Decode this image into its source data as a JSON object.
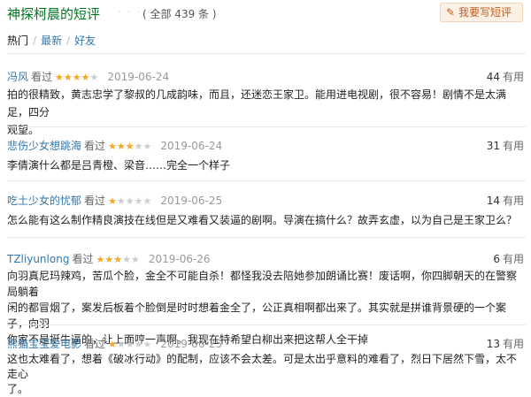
{
  "header": {
    "title": "神探柯晨的短评",
    "dots": "· · · · · ·",
    "total": "( 全部 439 条 )",
    "write_button_icon": "pencil-icon",
    "write_button": "我要写短评"
  },
  "tabs": {
    "hot": "热门",
    "sep1": "/",
    "latest": "最新",
    "sep2": "/",
    "friends": "好友"
  },
  "colors": {
    "title_green": "#007722",
    "link_blue": "#3377aa",
    "star_orange": "#f5a623",
    "button_text": "#bf5b1c"
  },
  "reviews": [
    {
      "user": "冯风",
      "status": "看过",
      "rating": 4,
      "date": "2019-06-24",
      "useful_count": "44",
      "useful_label": "有用",
      "line1": "拍的很精致，黄志忠学了黎叔的几成韵味，而且，还迷恋王家卫。能用进电视剧，很不容易！剧情不是太满足，四分",
      "line2": "观望。",
      "line3": ""
    },
    {
      "user": "悲伤少女想跳海",
      "status": "看过",
      "rating": 3,
      "date": "2019-06-24",
      "useful_count": "31",
      "useful_label": "有用",
      "line1": "李倩演什么都是吕青橙、梁音……完全一个样子",
      "line2": "",
      "line3": ""
    },
    {
      "user": "吃土少女的忧郁",
      "status": "看过",
      "rating": 1,
      "date": "2019-06-25",
      "useful_count": "14",
      "useful_label": "有用",
      "line1": "怎么能有这么制作精良演技在线但是又难看又装逼的剧啊。导演在搞什么？故弄玄虚，以为自己是王家卫么？",
      "line2": "",
      "line3": ""
    },
    {
      "user": "TZliyunlong",
      "status": "看过",
      "rating": 3,
      "date": "2019-06-26",
      "useful_count": "6",
      "useful_label": "有用",
      "line1": "向羽真尼玛辣鸡，苦瓜个脸，金全不可能自杀！都怪我没去陪她参加朗诵比赛！废话啊，你四脚朝天的在警察局躺着",
      "line2": "闲的都冒烟了，案发后板着个脸倒是时时想着金全了，公正真相啊都出来了。其实就是拼谁背景硬的一个案子，向羽",
      "line3": "你家不是挺牛逼的，让上面哼一声啊。我现在特希望白柳出来把这帮人全干掉"
    },
    {
      "user": "熊猫宝宝爱电影",
      "status": "看过",
      "rating": 1,
      "date": "2019-06-25",
      "useful_count": "13",
      "useful_label": "有用",
      "line1": "这也太难看了，想着《破冰行动》的配制，应该不会太差。可是太出乎意料的难看了，烈日下居然下雪，太不走心",
      "line2": "了。",
      "line3": ""
    }
  ]
}
